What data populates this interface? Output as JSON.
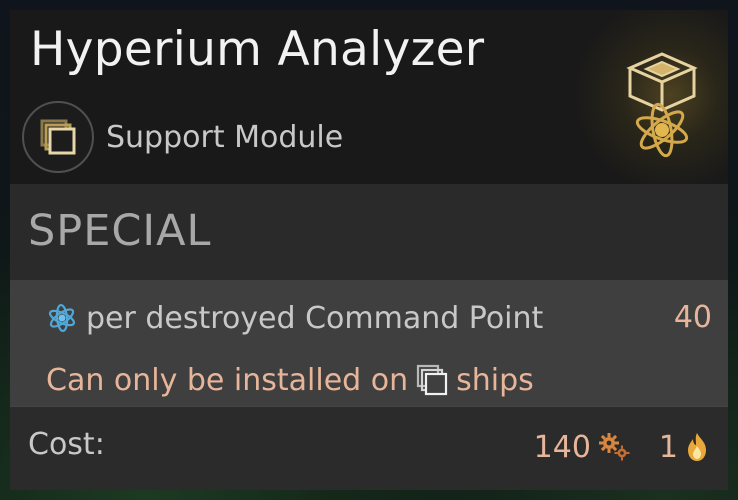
{
  "item": {
    "title": "Hyperium Analyzer",
    "type_label": "Support Module",
    "type_icon": "stacked-squares-icon",
    "module_icon": "cube-atom-icon"
  },
  "special": {
    "label": "SPECIAL",
    "effect_text": "per destroyed Command Point",
    "effect_value": "40",
    "effect_icon": "hyperium-atom-icon",
    "restriction_prefix": "Can only be installed on",
    "restriction_suffix": "ships",
    "restriction_icon": "support-ship-icon"
  },
  "cost": {
    "label": "Cost:",
    "metal_value": "140",
    "metal_icon": "gears-icon",
    "fuel_value": "1",
    "fuel_icon": "flame-icon"
  },
  "colors": {
    "accent_text": "#e7b59a",
    "gold": "#d4a94a",
    "atom_blue": "#4fa8d8"
  }
}
